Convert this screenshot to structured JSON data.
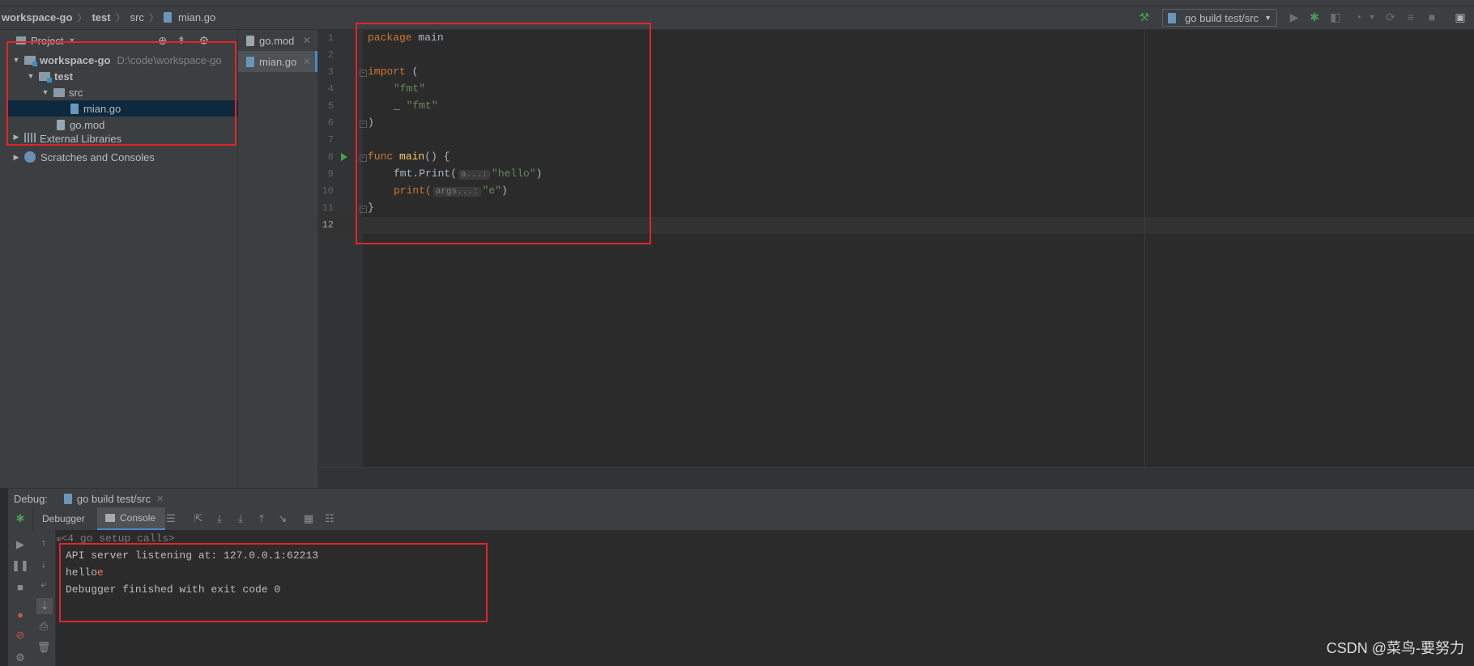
{
  "breadcrumb": [
    "workspace-go",
    "test",
    "src",
    "mian.go"
  ],
  "toolbar": {
    "run_config": "go build test/src"
  },
  "project": {
    "header": "Project",
    "tree": [
      {
        "label": "workspace-go",
        "hint": "D:\\code\\workspace-go"
      },
      {
        "label": "test"
      },
      {
        "label": "src"
      },
      {
        "label": "mian.go"
      },
      {
        "label": "go.mod"
      },
      {
        "label": "External Libraries"
      },
      {
        "label": "Scratches and Consoles"
      }
    ]
  },
  "editor_tabs": [
    {
      "label": "go.mod"
    },
    {
      "label": "mian.go"
    }
  ],
  "editor": {
    "line_numbers": [
      "1",
      "2",
      "3",
      "4",
      "5",
      "6",
      "7",
      "8",
      "9",
      "10",
      "11",
      "12"
    ],
    "code": {
      "l1_kw": "package",
      "l1_name": " main",
      "l3_kw": "import",
      "l3_rest": " (",
      "l4": "\"fmt\"",
      "l5_blank": "_ ",
      "l5_str": "\"fmt\"",
      "l6": ")",
      "l8_kw": "func",
      "l8_fn": " main",
      "l8_rest": "() {",
      "l9_call": "fmt.Print(",
      "l9_hint": "a...:",
      "l9_str": "\"hello\"",
      "l9_end": ")",
      "l10_fn": "print(",
      "l10_hint": "args...:",
      "l10_str": "\"e\"",
      "l10_end": ")",
      "l11": "}"
    }
  },
  "debug": {
    "label": "Debug:",
    "session": "go build test/src",
    "tabs": {
      "debugger": "Debugger",
      "console": "Console"
    },
    "console_lines": {
      "setup": "<4 go setup calls>",
      "api": "API server listening at: 127.0.0.1:62213",
      "hello": "hello",
      "hello_red": "e",
      "finished": "Debugger finished with exit code 0"
    }
  },
  "watermark": "CSDN @菜鸟-要努力"
}
